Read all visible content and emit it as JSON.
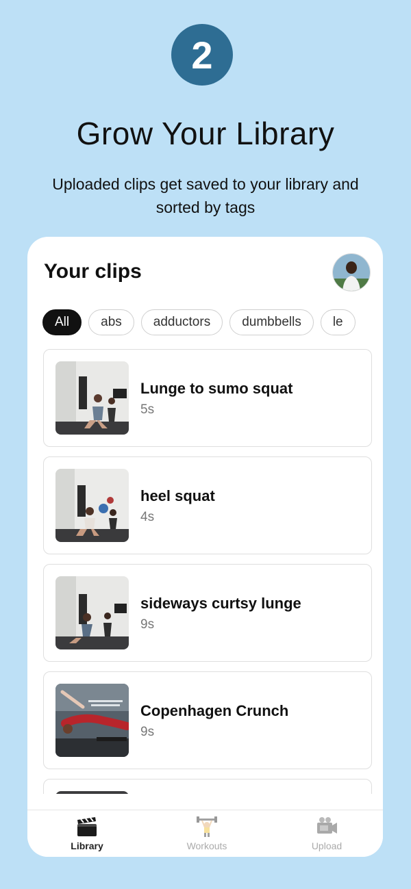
{
  "header": {
    "step_number": "2",
    "title": "Grow Your Library",
    "subtitle": "Uploaded clips get saved to your library and sorted by tags"
  },
  "library": {
    "title": "Your clips",
    "filters": [
      "All",
      "abs",
      "adductors",
      "dumbbells",
      "le"
    ],
    "active_filter": "All",
    "clips": [
      {
        "name": "Lunge to sumo squat",
        "duration": "5s",
        "thumbnail": "gym-video-thumbnail"
      },
      {
        "name": "heel squat",
        "duration": "4s",
        "thumbnail": "gym-video-thumbnail"
      },
      {
        "name": "sideways curtsy lunge",
        "duration": "9s",
        "thumbnail": "gym-video-thumbnail"
      },
      {
        "name": "Copenhagen Crunch",
        "duration": "9s",
        "thumbnail": "gym-video-thumbnail"
      }
    ]
  },
  "tabbar": {
    "tabs": [
      {
        "label": "Library",
        "icon": "clapperboard-icon",
        "active": true
      },
      {
        "label": "Workouts",
        "icon": "weightlifter-icon",
        "active": false
      },
      {
        "label": "Upload",
        "icon": "video-camera-icon",
        "active": false
      }
    ]
  },
  "colors": {
    "background": "#bde0f6",
    "step_badge": "#2e6d93",
    "active_chip": "#111111"
  }
}
